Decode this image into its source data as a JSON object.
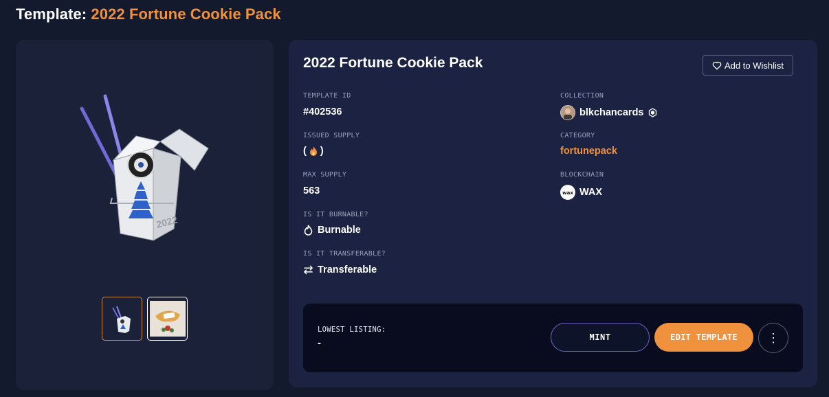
{
  "header": {
    "prefix": "Template:",
    "name": "2022 Fortune Cookie Pack"
  },
  "card": {
    "title": "2022 Fortune Cookie Pack",
    "wishlist_label": "Add to Wishlist"
  },
  "fields": {
    "template_id": {
      "label": "TEMPLATE ID",
      "value": "#402536"
    },
    "issued_supply": {
      "label": "ISSUED SUPPLY",
      "open": "(",
      "close": ")"
    },
    "max_supply": {
      "label": "MAX SUPPLY",
      "value": "563"
    },
    "burnable": {
      "label": "IS IT BURNABLE?",
      "value": "Burnable"
    },
    "transferable": {
      "label": "IS IT TRANSFERABLE?",
      "value": "Transferable"
    },
    "collection": {
      "label": "COLLECTION",
      "value": "blkchancards"
    },
    "category": {
      "label": "CATEGORY",
      "value": "fortunepack"
    },
    "blockchain": {
      "label": "BLOCKCHAIN",
      "value": "WAX",
      "logo_text": "wax"
    }
  },
  "listing": {
    "label": "LOWEST LISTING:",
    "value": "-"
  },
  "actions": {
    "mint_label": "MINT",
    "edit_label": "EDIT TEMPLATE",
    "more_icon": "⋮"
  },
  "images": {
    "box_year": "2022"
  },
  "colors": {
    "accent": "#f0913d",
    "background": "#141a2e",
    "panel": "#1c2241",
    "listing_box": "#080c1e"
  }
}
